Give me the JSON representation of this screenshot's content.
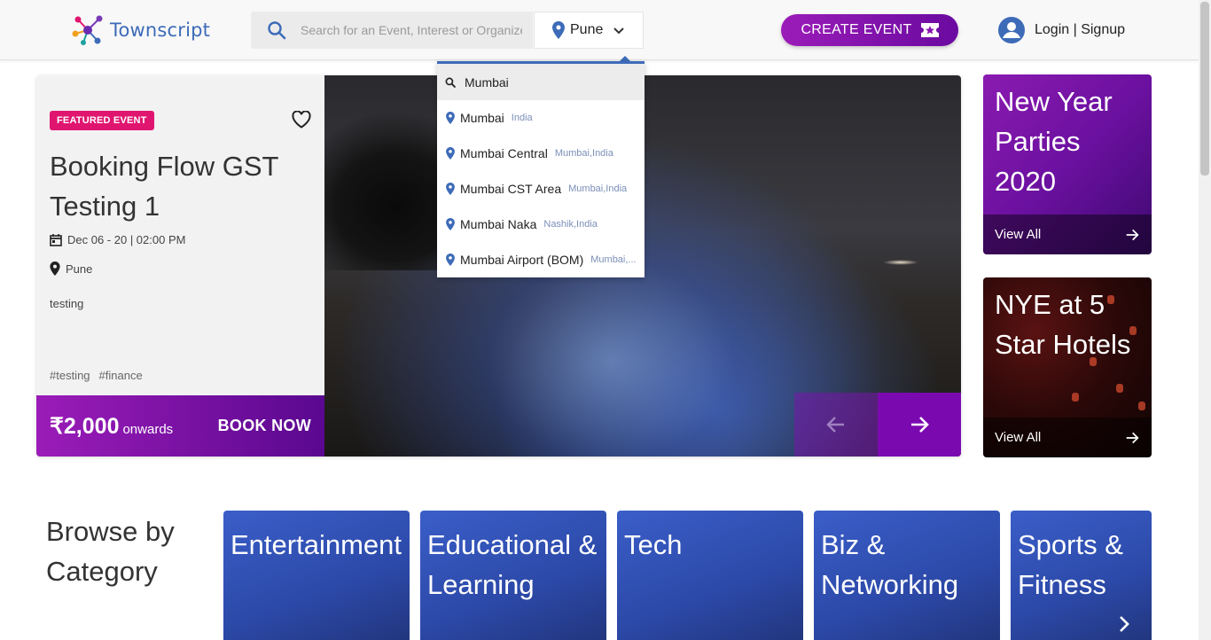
{
  "header": {
    "logo_text": "Townscript",
    "search_placeholder": "Search for an Event, Interest or Organizer",
    "city": "Pune",
    "create_event_label": "CREATE EVENT",
    "login_label": "Login | Signup"
  },
  "featured": {
    "badge": "FEATURED EVENT",
    "title": "Booking Flow GST Testing 1",
    "date": "Dec 06 - 20 | 02:00 PM",
    "location": "Pune",
    "description": "testing",
    "tags": [
      "#testing",
      "#finance"
    ],
    "price": "₹2,000",
    "price_suffix": "onwards",
    "book_label": "BOOK NOW"
  },
  "dropdown": {
    "query": "Mumbai",
    "items": [
      {
        "name": "Mumbai",
        "sub": "India"
      },
      {
        "name": "Mumbai Central",
        "sub": "Mumbai,India"
      },
      {
        "name": "Mumbai CST Area",
        "sub": "Mumbai,India"
      },
      {
        "name": "Mumbai Naka",
        "sub": "Nashik,India"
      },
      {
        "name": "Mumbai Airport (BOM)",
        "sub": "Mumbai,..."
      }
    ]
  },
  "promos": [
    {
      "title": "New Year Parties 2020",
      "link": "View All"
    },
    {
      "title": "NYE at 5 Star Hotels",
      "link": "View All"
    }
  ],
  "browse": {
    "title": "Browse by Category",
    "categories": [
      "Entertainment",
      "Educational & Learning",
      "Tech",
      "Biz & Networking",
      "Sports & Fitness"
    ]
  },
  "colors": {
    "brand_purple": "#8a12b4",
    "brand_blue": "#3d6bb8",
    "badge_pink": "#e0156f",
    "category_blue": "#2c49a8"
  },
  "icons": [
    "townscript-logo-icon",
    "search-icon",
    "location-pin-icon",
    "chevron-down-icon",
    "ticket-star-icon",
    "user-avatar-icon",
    "heart-icon",
    "calendar-icon",
    "arrow-left-icon",
    "arrow-right-icon",
    "chevron-right-icon"
  ]
}
